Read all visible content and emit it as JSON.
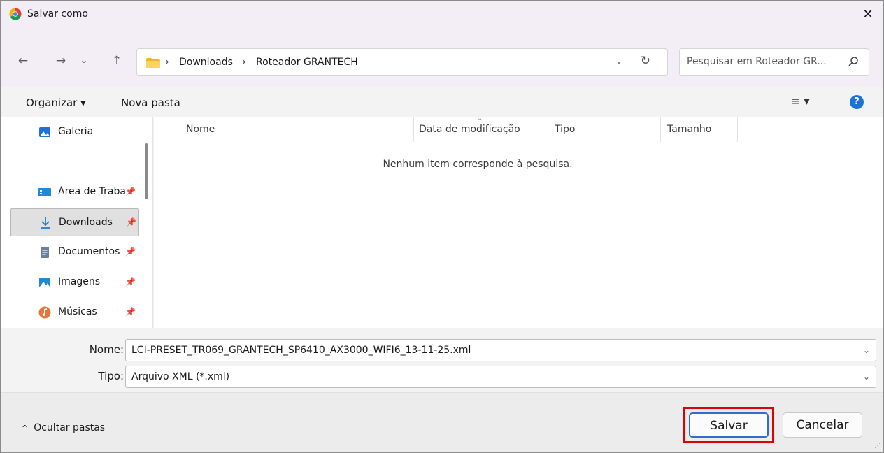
{
  "window": {
    "title": "Salvar como",
    "close_label": "✕"
  },
  "nav": {
    "back": "←",
    "forward": "→",
    "history": "⌄",
    "up": "↑",
    "breadcrumb": [
      "Downloads",
      "Roteador GRANTECH"
    ],
    "separator": "›",
    "dropdown": "⌄",
    "refresh": "↻"
  },
  "search": {
    "placeholder": "Pesquisar em Roteador GR..."
  },
  "toolbar": {
    "organize": "Organizar ▾",
    "new_folder": "Nova pasta",
    "view": "≡ ▾",
    "help": "?"
  },
  "sidebar": {
    "items": [
      {
        "label": "Galeria",
        "icon": "gallery-icon",
        "pinned": false,
        "selected": false
      },
      {
        "label": "Área de Trabalho",
        "icon": "desktop-icon",
        "pinned": true,
        "selected": false
      },
      {
        "label": "Downloads",
        "icon": "download-icon",
        "pinned": true,
        "selected": true
      },
      {
        "label": "Documentos",
        "icon": "document-icon",
        "pinned": true,
        "selected": false
      },
      {
        "label": "Imagens",
        "icon": "pictures-icon",
        "pinned": true,
        "selected": false
      },
      {
        "label": "Músicas",
        "icon": "music-icon",
        "pinned": true,
        "selected": false
      }
    ],
    "pin": "📌"
  },
  "filelist": {
    "columns": [
      "Nome",
      "Data de modificação",
      "Tipo",
      "Tamanho"
    ],
    "empty_message": "Nenhum item corresponde à pesquisa."
  },
  "fields": {
    "name_label": "Nome:",
    "name_value": "LCI-PRESET_TR069_GRANTECH_SP6410_AX3000_WIFI6_13-11-25.xml",
    "type_label": "Tipo:",
    "type_value": "Arquivo XML (*.xml)"
  },
  "footer": {
    "hide_folders_caret": "^",
    "hide_folders": "Ocultar pastas",
    "save": "Salvar",
    "cancel": "Cancelar"
  },
  "colors": {
    "accent": "#2c6fcf",
    "highlight": "#e00000",
    "titlebar": "#f3eef6"
  }
}
